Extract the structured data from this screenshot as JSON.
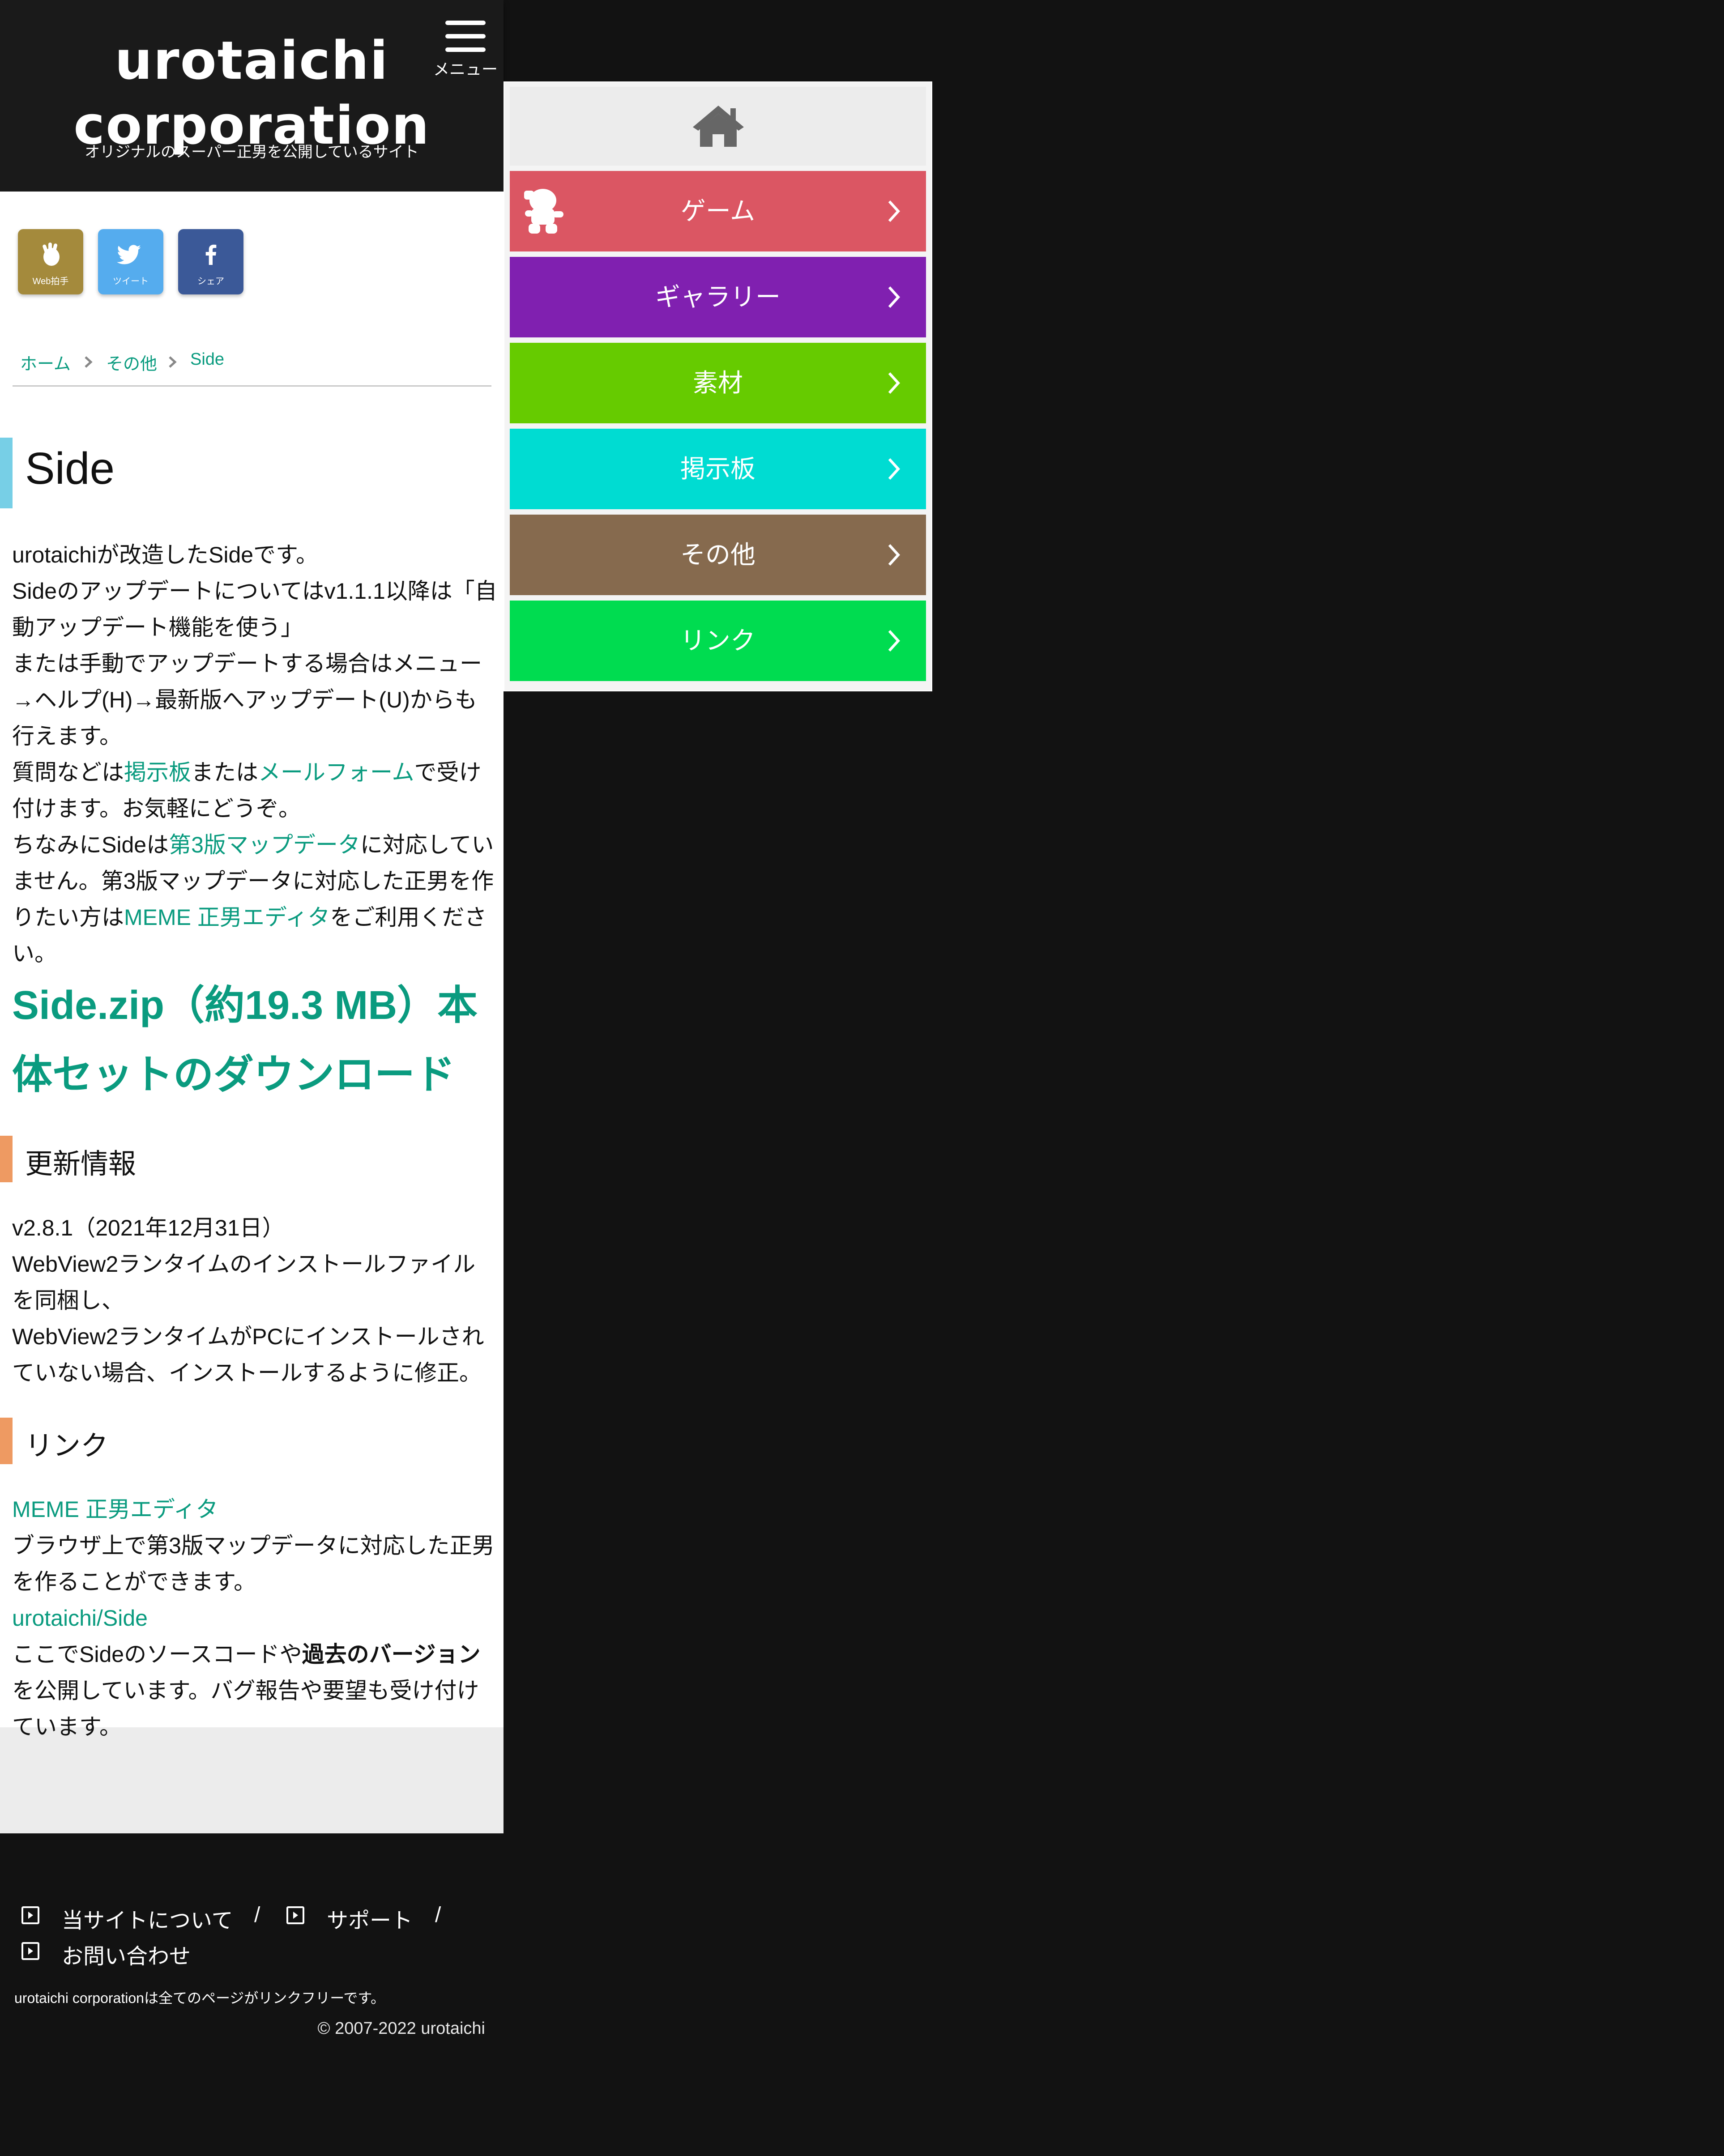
{
  "header": {
    "logo_line1": "urotaichi",
    "logo_line2": "corporation",
    "tagline": "オリジナルのスーパー正男を公開しているサイト",
    "menu_label": "メニュー"
  },
  "share": {
    "web_label": "Web拍手",
    "tweet_label": "ツイート",
    "share_label": "シェア"
  },
  "breadcrumb": {
    "home": "ホーム",
    "category": "その他",
    "current": "Side"
  },
  "page_title": "Side",
  "intro": {
    "p1": "urotaichiが改造したSideです。",
    "p2": "Sideのアップデートについてはv1.1.1以降は「自動アップデート機能を使う」",
    "p3": "または手動でアップデートする場合はメニュー→ヘルプ(H)→最新版へアップデート(U)からも行えます。",
    "p4_pre": "質問などは",
    "p4_link1": "掲示板",
    "p4_mid": "または",
    "p4_link2": "メールフォーム",
    "p4_post": "で受け付けます。お気軽にどうぞ。",
    "p5_pre": "ちなみにSideは",
    "p5_link1": "第3版マップデータ",
    "p5_mid": "に対応していません。第3版マップデータに対応した正男を作りたい方は",
    "p5_link2": "MEME 正男エディタ",
    "p5_post": "をご利用ください。"
  },
  "download_link": "Side.zip（約19.3 MB）本体セットのダウンロード",
  "updates": {
    "title": "更新情報",
    "version": "v2.8.1（2021年12月31日）",
    "line1": "WebView2ランタイムのインストールファイルを同梱し、",
    "line2": "WebView2ランタイムがPCにインストールされていない場合、インストールするように修正。"
  },
  "links": {
    "title": "リンク",
    "link1": "MEME 正男エディタ",
    "link1_desc": "ブラウザ上で第3版マップデータに対応した正男を作ることができます。",
    "link2": "urotaichi/Side",
    "link2_desc_pre": "ここでSideのソースコードや",
    "link2_desc_bold": "過去のバージョン",
    "link2_desc_post": "を公開しています。バグ報告や要望も受け付けています。"
  },
  "footer": {
    "about": "当サイトについて",
    "support": "サポート",
    "contact": "お問い合わせ",
    "separator": "/",
    "linkfree": "urotaichi corporationは全てのページがリンクフリーです。",
    "copyright": "© 2007-2022 urotaichi"
  },
  "nav_menu": {
    "items": [
      {
        "label": "ゲーム",
        "color": "#db5663"
      },
      {
        "label": "ギャラリー",
        "color": "#8020b0"
      },
      {
        "label": "素材",
        "color": "#66cb00"
      },
      {
        "label": "掲示板",
        "color": "#00dcd2"
      },
      {
        "label": "その他",
        "color": "#866a4e"
      },
      {
        "label": "リンク",
        "color": "#00dc50"
      }
    ]
  },
  "colors": {
    "accent_link": "#0a9b7f",
    "title_bar": "#77cfe6",
    "section_bar": "#ee9a62",
    "background": "#121212"
  },
  "icons": {
    "menu": "hamburger-icon",
    "home": "home-icon",
    "game": "masao-character-icon",
    "web_clap": "clap-icon",
    "twitter": "twitter-bird-icon",
    "facebook": "facebook-f-icon",
    "chevron": "chevron-right-icon",
    "footer_link": "play-square-icon"
  }
}
